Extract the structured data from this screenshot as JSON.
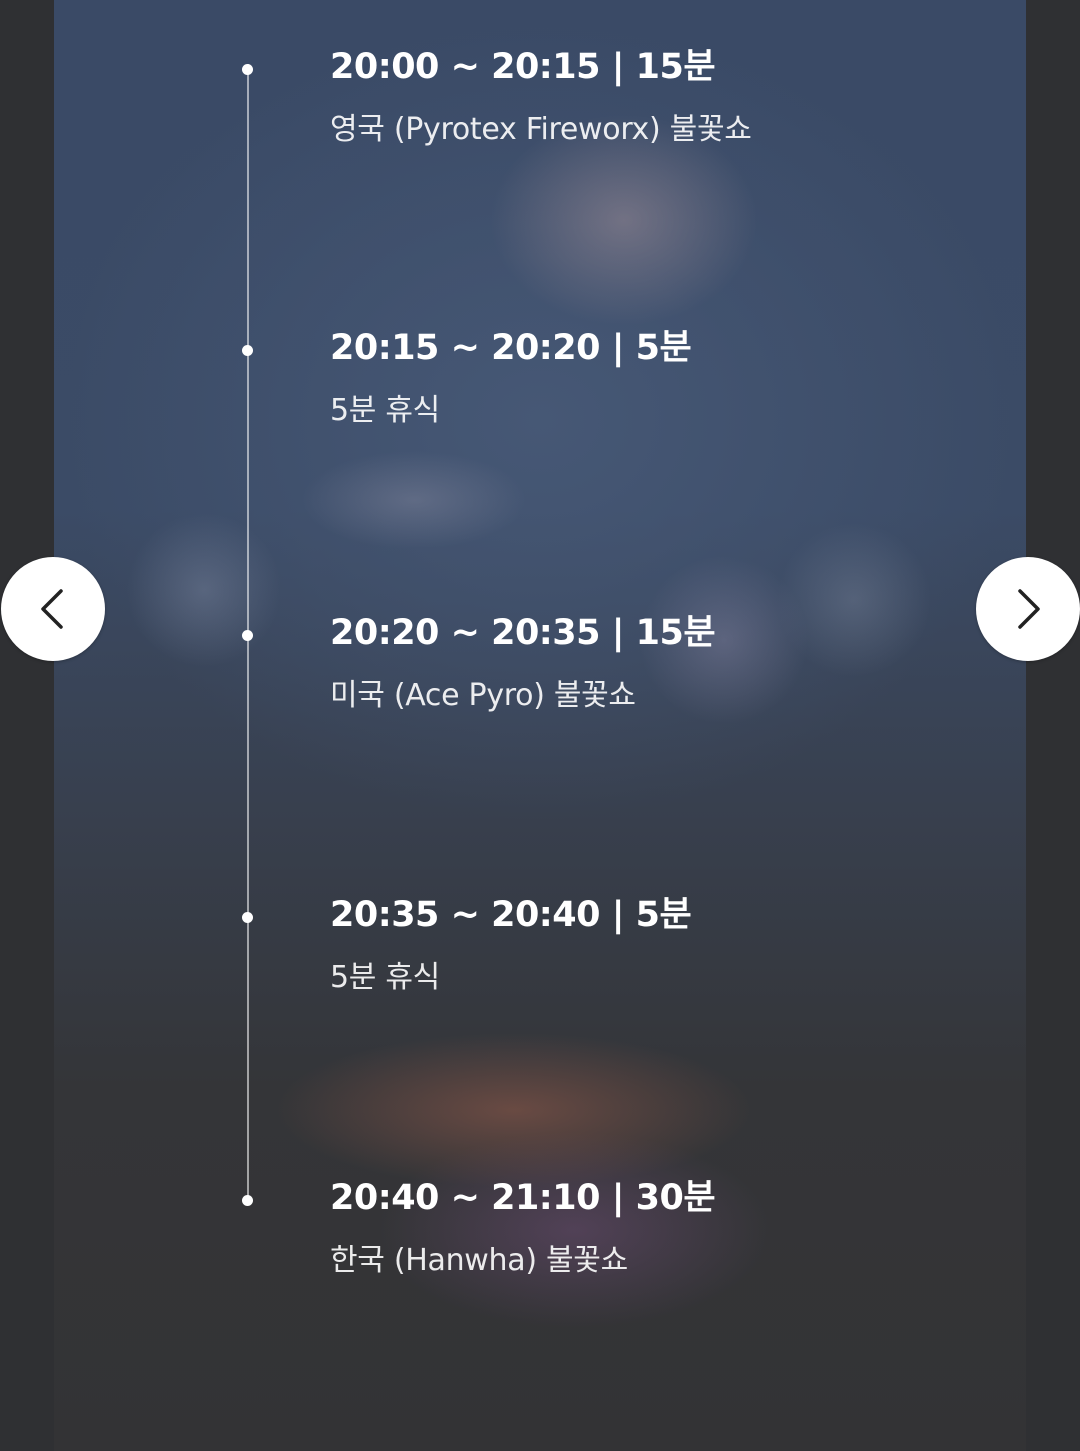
{
  "timeline": {
    "entries": [
      {
        "time": "20:00 ~ 20:15 | 15분",
        "desc": "영국 (Pyrotex Fireworx) 불꽃쇼"
      },
      {
        "time": "20:15 ~ 20:20 | 5분",
        "desc": "5분 휴식"
      },
      {
        "time": "20:20 ~ 20:35 | 15분",
        "desc": "미국 (Ace Pyro) 불꽃쇼"
      },
      {
        "time": "20:35 ~ 20:40 | 5분",
        "desc": "5분 휴식"
      },
      {
        "time": "20:40 ~ 21:10 | 30분",
        "desc": "한국 (Hanwha) 불꽃쇼"
      }
    ]
  },
  "navigation": {
    "prev_icon": "chevron-left-icon",
    "next_icon": "chevron-right-icon"
  },
  "colors": {
    "text": "#ffffff",
    "button_bg": "#ffffff",
    "chevron": "#222222"
  }
}
